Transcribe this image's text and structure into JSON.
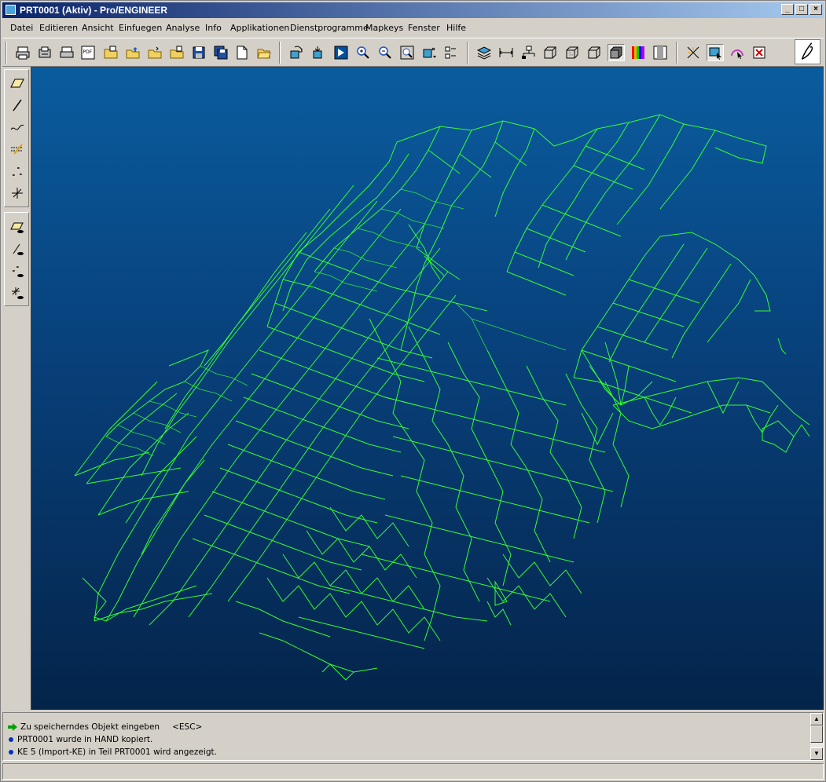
{
  "window": {
    "title": "PRT0001 (Aktiv) - Pro/ENGINEER",
    "minimize": "_",
    "maximize": "□",
    "close": "×"
  },
  "menu": [
    {
      "label": "Datei"
    },
    {
      "label": "Editieren"
    },
    {
      "label": "Ansicht"
    },
    {
      "label": "Einfuegen"
    },
    {
      "label": "Analyse"
    },
    {
      "label": "Info"
    },
    {
      "label": "Applikationen"
    },
    {
      "label": "Dienstprogramme"
    },
    {
      "label": "Mapkeys"
    },
    {
      "label": "Fenster"
    },
    {
      "label": "Hilfe"
    }
  ],
  "toolbar": {
    "pdf_label": "PDF"
  },
  "colors": {
    "mesh": "#33ff33",
    "viewport_top": "#0a5c9e",
    "viewport_bottom": "#04244a",
    "title_bar": "#0a246a"
  },
  "messages": [
    {
      "text": "Zu speicherndes Objekt eingeben",
      "suffix": "<ESC>",
      "icon": "arrow-prompt-icon"
    },
    {
      "text": "PRT0001 wurde in HAND kopiert.",
      "icon": "info-dot-icon"
    },
    {
      "text": "KE 5 (Import-KE) in Teil PRT0001 wird angezeigt.",
      "icon": "info-dot-icon"
    }
  ]
}
